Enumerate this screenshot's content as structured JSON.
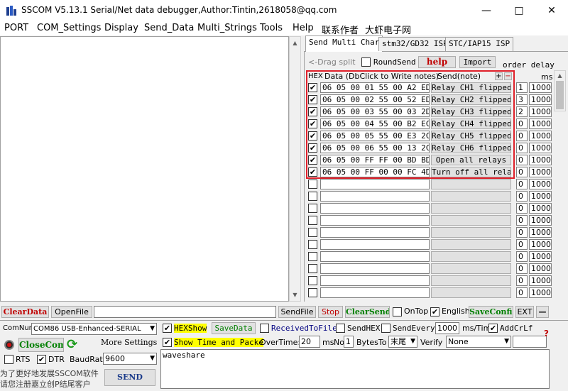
{
  "window": {
    "title": "SSCOM V5.13.1 Serial/Net data debugger,Author:Tintin,2618058@qq.com"
  },
  "menu": [
    "PORT",
    "COM_Settings",
    "Display",
    "Send_Data",
    "Multi_Strings",
    "Tools",
    "Help",
    "联系作者",
    "大虾电子网"
  ],
  "tabs": [
    "Send Multi Char",
    "stm32/GD32 ISP",
    "STC/IAP15 ISP"
  ],
  "multi": {
    "drag_split": "<-Drag split",
    "round_send": "RoundSend",
    "help": "help",
    "import": "Import",
    "order_delay": "order delay",
    "hex_header": "HEX",
    "data_header": "Data (DbClick to Write notes)",
    "note_header": "Send(note)",
    "plus": "+",
    "minus": "−",
    "ms": "ms",
    "rows": [
      {
        "checked": true,
        "data": "06 05 00 01 55 00 A2 ED",
        "note": "Relay CH1 flipped",
        "order": "1",
        "delay": "1000"
      },
      {
        "checked": true,
        "data": "06 05 00 02 55 00 52 ED",
        "note": "Relay CH2 flipped",
        "order": "3",
        "delay": "1000"
      },
      {
        "checked": true,
        "data": "06 05 00 03 55 00 03 2D",
        "note": "Relay CH3 flipped",
        "order": "2",
        "delay": "1000"
      },
      {
        "checked": true,
        "data": "06 05 00 04 55 00 B2 EC",
        "note": "Relay CH4 flipped",
        "order": "0",
        "delay": "1000"
      },
      {
        "checked": true,
        "data": "06 05 00 05 55 00 E3 2C",
        "note": "Relay CH5 flipped",
        "order": "0",
        "delay": "1000"
      },
      {
        "checked": true,
        "data": "06 05 00 06 55 00 13 2C",
        "note": "Relay CH6 flipped",
        "order": "0",
        "delay": "1000"
      },
      {
        "checked": true,
        "data": "06 05 00 FF FF 00 BD BD",
        "note": "Open all relays",
        "order": "0",
        "delay": "1000"
      },
      {
        "checked": true,
        "data": "06 05 00 FF 00 00 FC 4D",
        "note": "Turn off all relays",
        "order": "0",
        "delay": "1000"
      },
      {
        "checked": false,
        "data": "",
        "note": "",
        "order": "0",
        "delay": "1000"
      },
      {
        "checked": false,
        "data": "",
        "note": "",
        "order": "0",
        "delay": "1000"
      },
      {
        "checked": false,
        "data": "",
        "note": "",
        "order": "0",
        "delay": "1000"
      },
      {
        "checked": false,
        "data": "",
        "note": "",
        "order": "0",
        "delay": "1000"
      },
      {
        "checked": false,
        "data": "",
        "note": "",
        "order": "0",
        "delay": "1000"
      },
      {
        "checked": false,
        "data": "",
        "note": "",
        "order": "0",
        "delay": "1000"
      },
      {
        "checked": false,
        "data": "",
        "note": "",
        "order": "0",
        "delay": "1000"
      },
      {
        "checked": false,
        "data": "",
        "note": "",
        "order": "0",
        "delay": "1000"
      },
      {
        "checked": false,
        "data": "",
        "note": "",
        "order": "0",
        "delay": "1000"
      },
      {
        "checked": false,
        "data": "",
        "note": "",
        "order": "0",
        "delay": "1000"
      }
    ]
  },
  "toolbar": {
    "clear_data": "ClearData",
    "open_file": "OpenFile",
    "send_file": "SendFile",
    "stop": "Stop",
    "clear_send": "ClearSend",
    "on_top": "OnTop",
    "english": "English",
    "save_config": "SaveConfig",
    "ext": "EXT",
    "dash": "—"
  },
  "settings": {
    "com_num_label": "ComNum",
    "com_port": "COM86 USB-Enhanced-SERIAL",
    "close_com": "CloseCom",
    "more_settings": "More Settings",
    "rts": "RTS",
    "dtr": "DTR",
    "baud_label": "BaudRat",
    "baud": "9600",
    "hex_show": "HEXShow",
    "save_data": "SaveData",
    "received_to_file": "ReceivedToFile",
    "send_hex": "SendHEX",
    "send_every": "SendEvery:",
    "send_every_ms": "1000",
    "ms_tim": "ms/Tim",
    "add_crlf": "AddCrLf",
    "show_time": "Show Time and Packe",
    "over_time": "OverTime:",
    "over_time_val": "20",
    "ms": "ms",
    "no_label": "No",
    "no_val": "1",
    "bytes_to": "BytesTo",
    "bytes_to_val": "末尾",
    "verify": "Verify",
    "verify_val": "None",
    "question": "?",
    "promo_line1": "为了更好地发展SSCOM软件",
    "promo_line2": "请您注册嘉立创P结尾客户",
    "send": "SEND",
    "send_text": "waveshare"
  }
}
